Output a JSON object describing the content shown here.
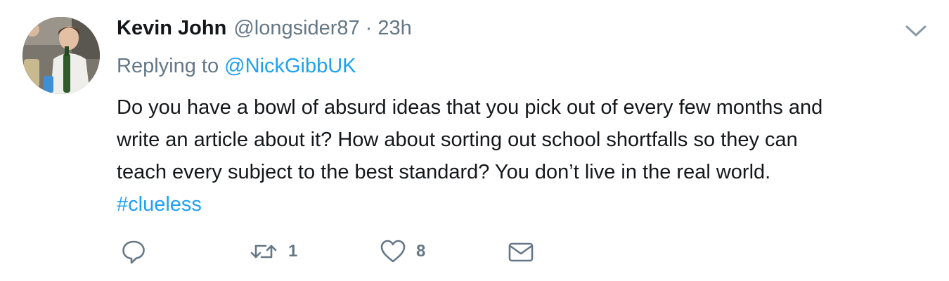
{
  "tweet": {
    "author": {
      "name": "Kevin John",
      "handle": "@longsider87"
    },
    "separator": "·",
    "time": "23h",
    "reply_context": {
      "prefix": "Replying to",
      "mention": "@NickGibbUK"
    },
    "text_lines": [
      "Do you have a bowl of absurd ideas that you pick out of every few months and",
      "write an article about it? How about sorting out school shortfalls so they can",
      "teach every subject to the best standard? You don’t live in the real world."
    ],
    "hashtag": "#clueless",
    "actions": {
      "reply_icon": "reply-icon",
      "retweet_icon": "retweet-icon",
      "retweet_count": "1",
      "like_icon": "heart-icon",
      "like_count": "8",
      "message_icon": "envelope-icon"
    },
    "menu_icon": "chevron-down-icon"
  },
  "colors": {
    "text": "#14171a",
    "secondary": "#657786",
    "link": "#1da1f2"
  }
}
